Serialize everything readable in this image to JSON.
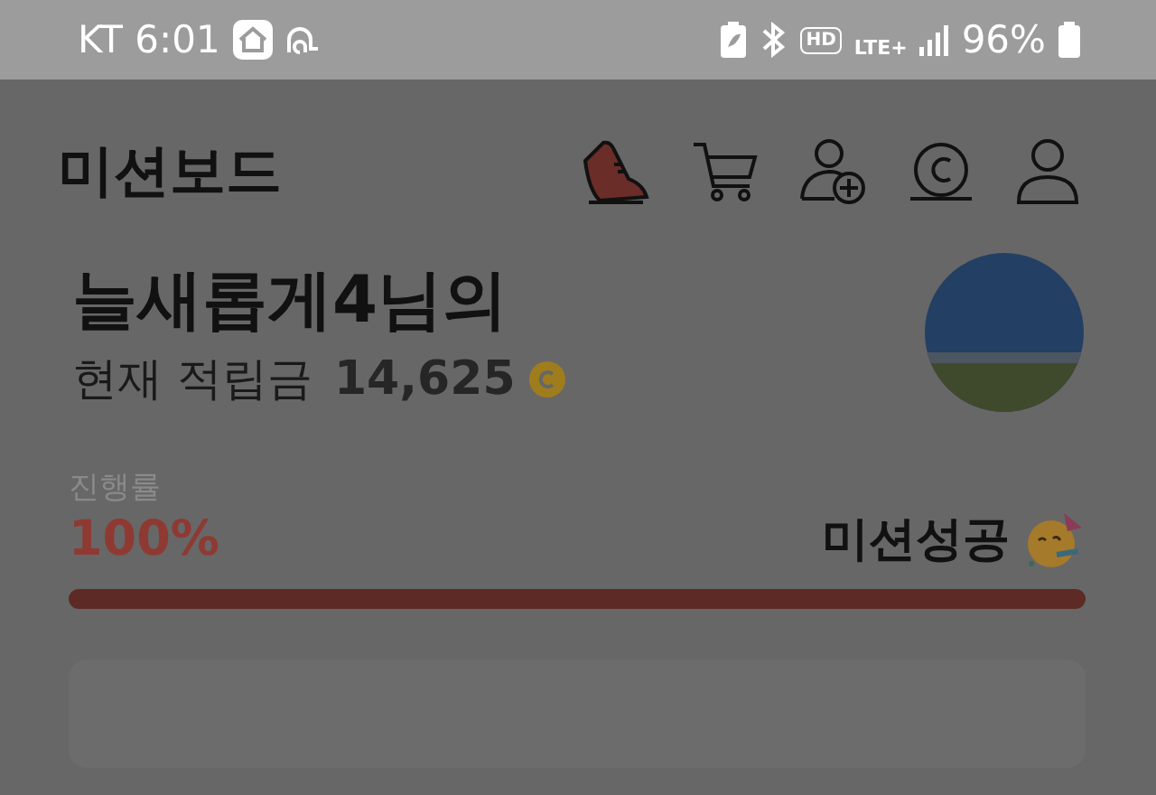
{
  "status_bar": {
    "carrier_time": "KT 6:01",
    "hd": "HD",
    "network": "LTE+",
    "battery": "96%"
  },
  "header": {
    "title": "미션보드"
  },
  "profile": {
    "name": "늘새롭게4님의",
    "balance_label": "현재 적립금",
    "balance": "14,625"
  },
  "progress": {
    "label": "진행률",
    "percent": "100%",
    "status": "미션성공",
    "level": 1.0
  }
}
